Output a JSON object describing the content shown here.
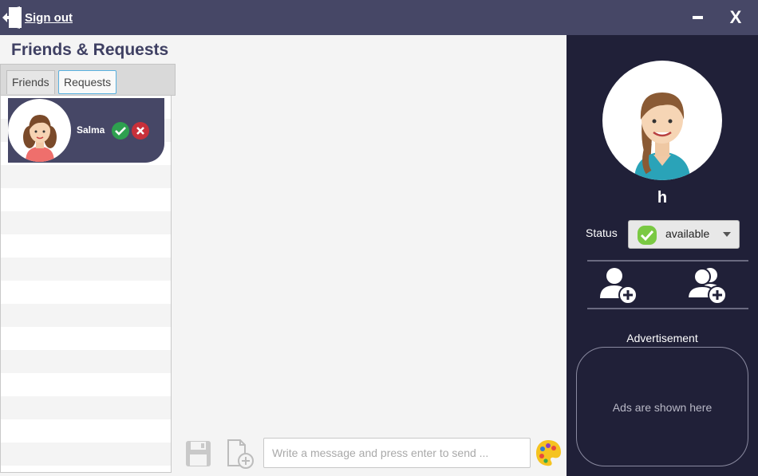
{
  "titlebar": {
    "signout_label": "Sign out",
    "close_label": "X"
  },
  "left": {
    "title": "Friends & Requests",
    "tabs": [
      {
        "label": "Friends",
        "selected": false
      },
      {
        "label": "Requests",
        "selected": true
      }
    ],
    "requests": [
      {
        "name": "Salma"
      }
    ]
  },
  "chat": {
    "placeholder": "Write a message and press enter to send ..."
  },
  "profile": {
    "name": "h",
    "status_label": "Status",
    "status_value": "available",
    "ad_label": "Advertisement",
    "ad_text": "Ads are shown here"
  },
  "colors": {
    "titlebar": "#464766",
    "sidebar": "#202038",
    "accept": "#2ea04f",
    "decline": "#c8303a",
    "status_ok": "#7ac943"
  }
}
